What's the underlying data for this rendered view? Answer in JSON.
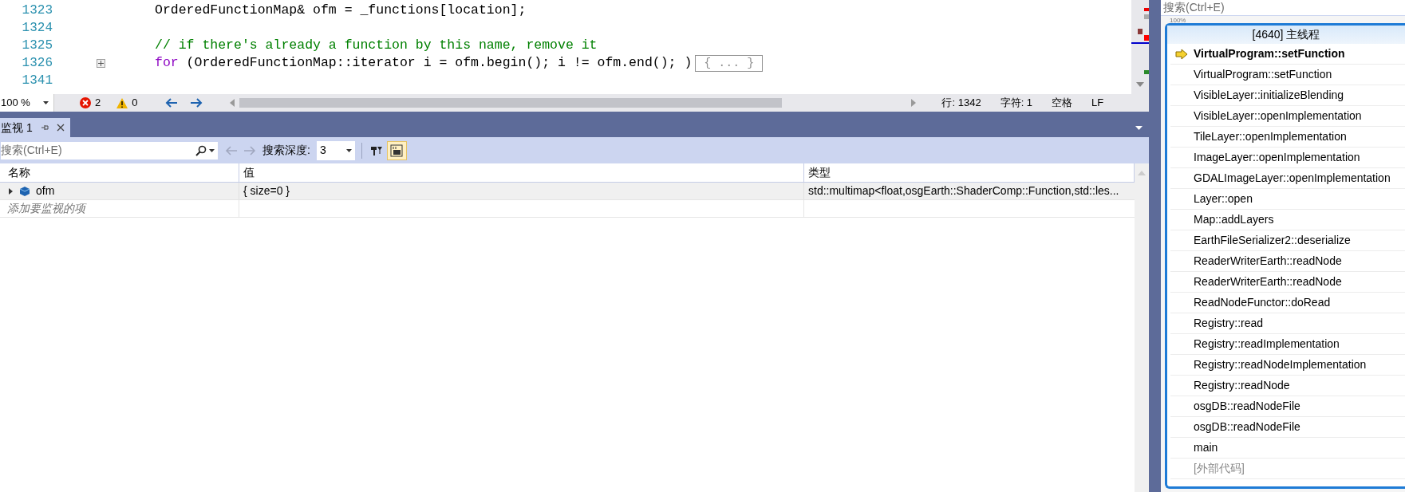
{
  "editor": {
    "lines": [
      {
        "number": "1323",
        "tokens": [
          {
            "kind": "plain",
            "text": "OrderedFunctionMap& ofm = _functions[location];"
          }
        ]
      },
      {
        "number": "1324"
      },
      {
        "number": "1325",
        "tokens": [
          {
            "kind": "comment",
            "text": "// if there's already a function by this name, remove it"
          }
        ]
      },
      {
        "number": "1326",
        "foldable": true,
        "tokens": [
          {
            "kind": "keyword",
            "text": "for"
          },
          {
            "kind": "plain",
            "text": " (OrderedFunctionMap::iterator i = ofm.begin(); i != ofm.end(); )"
          }
        ],
        "collapsed": "{ ... }"
      },
      {
        "number": "1341"
      }
    ]
  },
  "status_bar": {
    "zoom": "100 %",
    "errors": "2",
    "warnings": "0",
    "line": "行: 1342",
    "char": "字符: 1",
    "indent": "空格",
    "eol": "LF"
  },
  "watch": {
    "tab": {
      "title": "监视 1"
    },
    "search": {
      "placeholder": "搜索(Ctrl+E)"
    },
    "depth_label": "搜索深度:",
    "depth": "3",
    "display_toggle": {
      "on": true
    },
    "columns": [
      "名称",
      "值",
      "类型"
    ],
    "rows": [
      {
        "name": "ofm",
        "value": "{ size=0 }",
        "type": "std::multimap<float,osgEarth::ShaderComp::Function,std::les...",
        "expanded": false
      }
    ],
    "add_placeholder": "添加要监视的项"
  },
  "call_stack": {
    "search": {
      "placeholder": "搜索(Ctrl+E)"
    },
    "zoom": "100%",
    "thread": "[4640] 主线程",
    "frames": [
      {
        "name": "VirtualProgram::setFunction",
        "current": true,
        "external": false
      },
      {
        "name": "VirtualProgram::setFunction",
        "current": false,
        "external": false
      },
      {
        "name": "VisibleLayer::initializeBlending",
        "current": false,
        "external": false
      },
      {
        "name": "VisibleLayer::openImplementation",
        "current": false,
        "external": false
      },
      {
        "name": "TileLayer::openImplementation",
        "current": false,
        "external": false
      },
      {
        "name": "ImageLayer::openImplementation",
        "current": false,
        "external": false
      },
      {
        "name": "GDALImageLayer::openImplementation",
        "current": false,
        "external": false
      },
      {
        "name": "Layer::open",
        "current": false,
        "external": false
      },
      {
        "name": "Map::addLayers",
        "current": false,
        "external": false
      },
      {
        "name": "EarthFileSerializer2::deserialize",
        "current": false,
        "external": false
      },
      {
        "name": "ReaderWriterEarth::readNode",
        "current": false,
        "external": false
      },
      {
        "name": "ReaderWriterEarth::readNode",
        "current": false,
        "external": false
      },
      {
        "name": "ReadNodeFunctor::doRead",
        "current": false,
        "external": false
      },
      {
        "name": "Registry::read",
        "current": false,
        "external": false
      },
      {
        "name": "Registry::readImplementation",
        "current": false,
        "external": false
      },
      {
        "name": "Registry::readNodeImplementation",
        "current": false,
        "external": false
      },
      {
        "name": "Registry::readNode",
        "current": false,
        "external": false
      },
      {
        "name": "osgDB::readNodeFile",
        "current": false,
        "external": false
      },
      {
        "name": "osgDB::readNodeFile",
        "current": false,
        "external": false
      },
      {
        "name": "main",
        "current": false,
        "external": false
      },
      {
        "name": "[外部代码]",
        "current": false,
        "external": true
      }
    ]
  }
}
